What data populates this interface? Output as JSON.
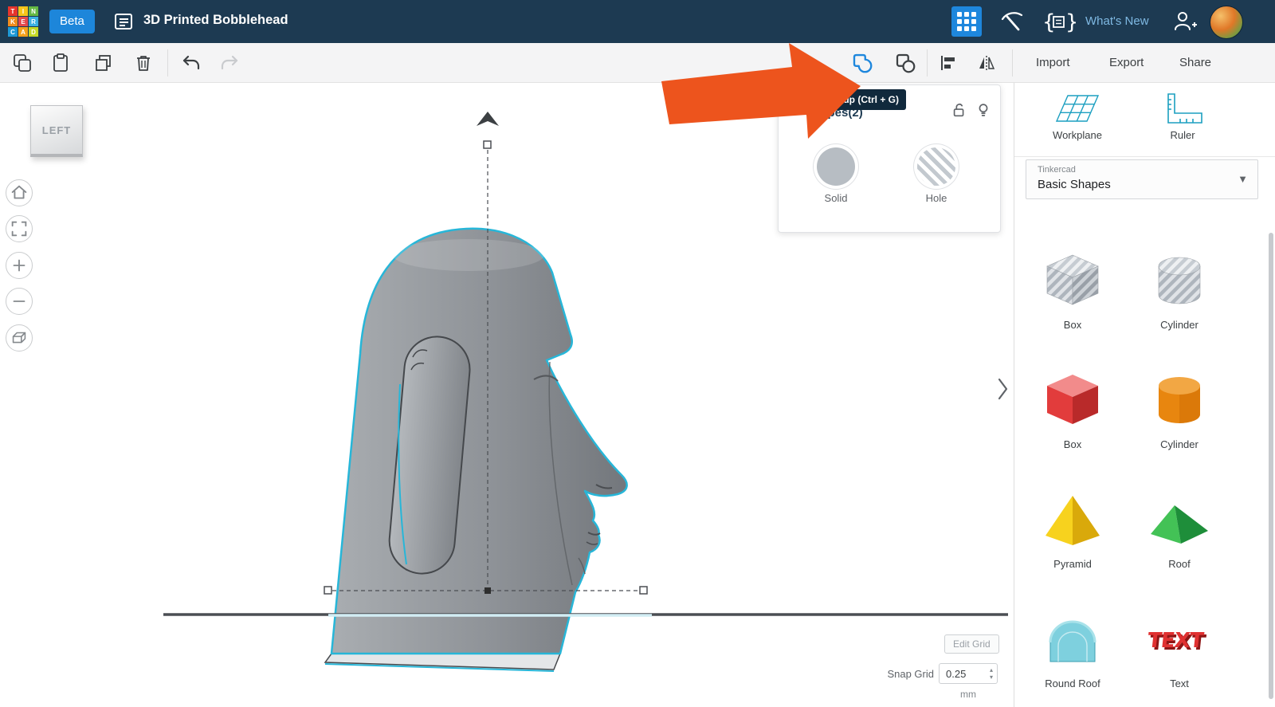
{
  "header": {
    "logo_letters": [
      "T",
      "I",
      "N",
      "K",
      "E",
      "R",
      "C",
      "A",
      "D"
    ],
    "beta_label": "Beta",
    "document_title": "3D Printed Bobblehead",
    "whats_new_label": "What's New"
  },
  "toolbar": {
    "import_label": "Import",
    "export_label": "Export",
    "share_label": "Share"
  },
  "tooltip": {
    "group_shortcut": "Group (Ctrl + G)"
  },
  "inspector": {
    "title": "Shapes(2)",
    "solid_label": "Solid",
    "hole_label": "Hole"
  },
  "viewcube": {
    "face_label": "LEFT"
  },
  "shapes_panel": {
    "workplane_label": "Workplane",
    "ruler_label": "Ruler",
    "library_brand": "Tinkercad",
    "library_name": "Basic Shapes",
    "shapes": [
      {
        "label": "Box"
      },
      {
        "label": "Cylinder"
      },
      {
        "label": "Box"
      },
      {
        "label": "Cylinder"
      },
      {
        "label": "Pyramid"
      },
      {
        "label": "Roof"
      },
      {
        "label": "Round Roof"
      },
      {
        "label": "Text",
        "preview": "TEXT"
      }
    ]
  },
  "grid_controls": {
    "edit_grid_label": "Edit Grid",
    "snap_grid_label": "Snap Grid",
    "snap_value": "0.25",
    "unit_label": "mm"
  },
  "icons": {
    "header": [
      "tinkercad-logo",
      "design-properties-icon",
      "apps-grid-icon",
      "tools-icon",
      "codeblocks-icon",
      "add-user-icon",
      "avatar"
    ],
    "toolbar_left": [
      "copy-icon",
      "paste-icon",
      "duplicate-icon",
      "delete-icon",
      "undo-icon",
      "redo-icon"
    ],
    "toolbar_right": [
      "group-icon",
      "ungroup-icon",
      "align-icon",
      "mirror-icon"
    ],
    "nav": [
      "home-icon",
      "fit-view-icon",
      "zoom-in-icon",
      "zoom-out-icon",
      "perspective-icon"
    ],
    "inspector_icons": [
      "unlock-icon",
      "show-hide-icon"
    ],
    "panel": [
      "workplane-icon",
      "ruler-icon",
      "chevron-down-icon",
      "panel-collapse-icon"
    ]
  },
  "colors": {
    "header_bg": "#1d3a52",
    "accent_blue": "#1e87dd",
    "selection_cyan": "#27b6d8",
    "annotation_orange": "#ed541d"
  }
}
